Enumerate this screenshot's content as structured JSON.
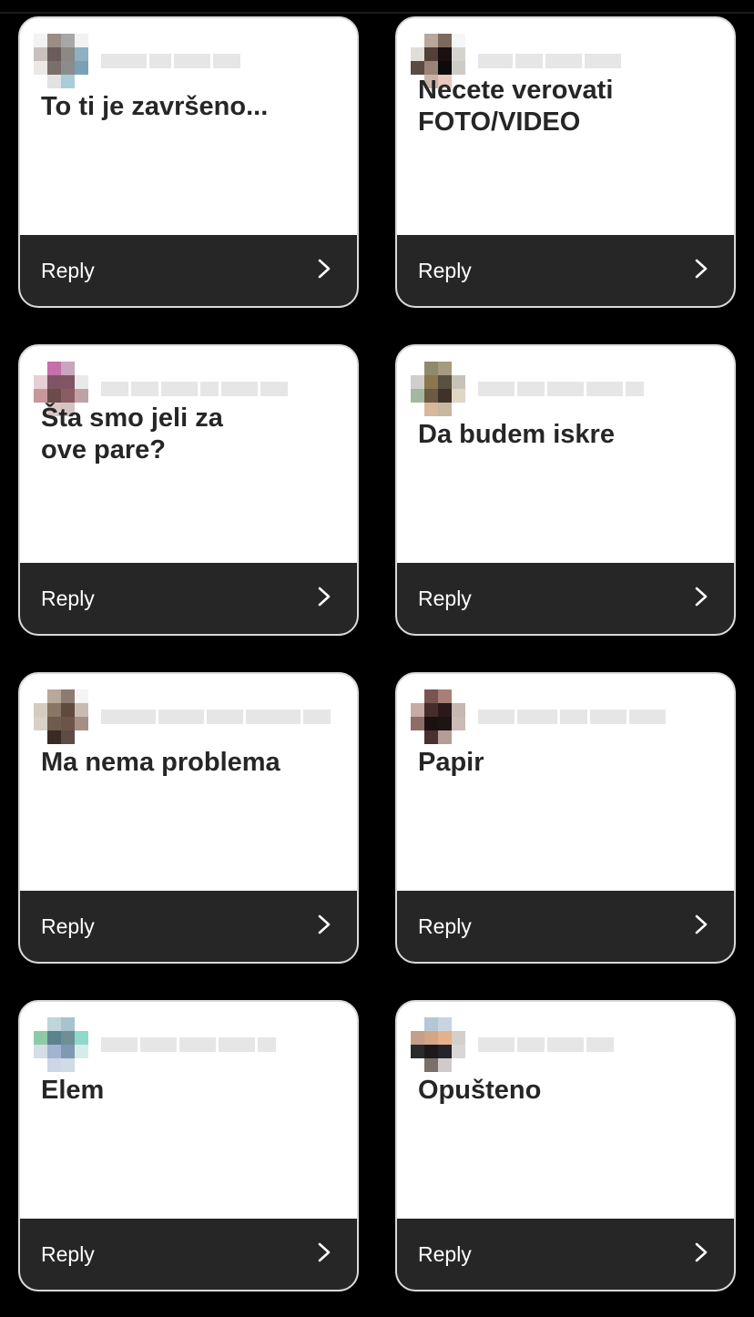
{
  "theme": {
    "background": "#000000",
    "card_bg": "#ffffff",
    "reply_bar_bg": "#262626",
    "text_dark": "#262626",
    "text_light": "#ffffff"
  },
  "reply_chevron_icon": "chevron-right-icon",
  "cards": [
    {
      "message": "To ti je završeno...",
      "reply_label": "Reply",
      "avatar": [
        "#f2f2f2",
        "#9a8d86",
        "#a7a7a7",
        "#f2f2f2",
        "#c7c0bc",
        "#6c5b5b",
        "#8c8884",
        "#8fb0c2",
        "#ebe8e6",
        "#7b6f6e",
        "#8a8c8e",
        "#7aa0b5",
        "#ffffff",
        "#e2e2e2",
        "#a9cdd8",
        "#ffffff"
      ],
      "username_bars": [
        50,
        24,
        40,
        30
      ]
    },
    {
      "message": "Necete verovati\nFOTO/VIDEO",
      "reply_label": "Reply",
      "avatar": [
        "#ffffff",
        "#b9a79b",
        "#7e6a5d",
        "#f6f6f6",
        "#e1ddd8",
        "#534038",
        "#1a1010",
        "#d6d3cf",
        "#5a4b44",
        "#9a8476",
        "#0c0b0b",
        "#cfcac6",
        "#ffffff",
        "#c9b4a9",
        "#e7c7c0",
        "#ffffff"
      ],
      "username_bars": [
        38,
        30,
        40,
        40
      ]
    },
    {
      "message": "Šta smo jeli za\nove pare?",
      "reply_label": "Reply",
      "avatar": [
        "#ffffff",
        "#c56fab",
        "#c9a6bc",
        "#ffffff",
        "#e6cfd5",
        "#7e5562",
        "#825565",
        "#e9e9ea",
        "#c89799",
        "#6d4a4b",
        "#8a5d62",
        "#bfa2a6",
        "#ffffff",
        "#d9c7c6",
        "#d3c4c3",
        "#ffffff"
      ],
      "username_bars": [
        30,
        30,
        40,
        20,
        40,
        30
      ]
    },
    {
      "message": "Da budem iskre",
      "reply_label": "Reply",
      "avatar": [
        "#ffffff",
        "#8f8a6c",
        "#a69a80",
        "#ffffff",
        "#cfd0cb",
        "#8a7650",
        "#5a5040",
        "#c7c2b8",
        "#a4b79f",
        "#6b5a44",
        "#403228",
        "#dfd6c6",
        "#ffffff",
        "#d7b89c",
        "#c8b69f",
        "#ffffff"
      ],
      "username_bars": [
        40,
        30,
        40,
        40,
        20
      ]
    },
    {
      "message": "Ma nema problema",
      "reply_label": "Reply",
      "avatar": [
        "#ffffff",
        "#b7a89a",
        "#8e7a70",
        "#f4f4f4",
        "#d3ccbf",
        "#8b7564",
        "#5f4a40",
        "#c8bcb2",
        "#d9d1c7",
        "#6f5a4e",
        "#6c544a",
        "#a58f84",
        "#ffffff",
        "#3a2a24",
        "#5e4c44",
        "#ffffff"
      ],
      "username_bars": [
        60,
        50,
        40,
        60,
        30
      ]
    },
    {
      "message": "Papir",
      "reply_label": "Reply",
      "avatar": [
        "#ffffff",
        "#7a5550",
        "#a77f77",
        "#ffffff",
        "#c6aca5",
        "#452d2a",
        "#2b1919",
        "#c6b7b1",
        "#8d6e66",
        "#1c1111",
        "#1d1414",
        "#cbbbb6",
        "#ffffff",
        "#4a3030",
        "#b49d96",
        "#ffffff"
      ],
      "username_bars": [
        40,
        44,
        30,
        40,
        40
      ]
    },
    {
      "message": "Elem",
      "reply_label": "Reply",
      "avatar": [
        "#ffffff",
        "#bfd4db",
        "#a6c4cd",
        "#ffffff",
        "#8fcaa7",
        "#5b838d",
        "#6e8f96",
        "#8fd8cc",
        "#d4dde8",
        "#a1b3d0",
        "#7f98b4",
        "#d8ebeb",
        "#ffffff",
        "#cdd6e6",
        "#cfdbe5",
        "#ffffff"
      ],
      "username_bars": [
        40,
        40,
        40,
        40,
        20
      ]
    },
    {
      "message": "Opušteno",
      "reply_label": "Reply",
      "avatar": [
        "#ffffff",
        "#b5c7d6",
        "#c8d4e0",
        "#ffffff",
        "#c69f8a",
        "#d3a684",
        "#e5b18c",
        "#d3cfcc",
        "#2b2b2e",
        "#1c1a1d",
        "#24242a",
        "#d8d6d6",
        "#ffffff",
        "#7a6f6a",
        "#d0cbc8",
        "#ffffff"
      ],
      "username_bars": [
        40,
        30,
        40,
        30
      ]
    }
  ]
}
